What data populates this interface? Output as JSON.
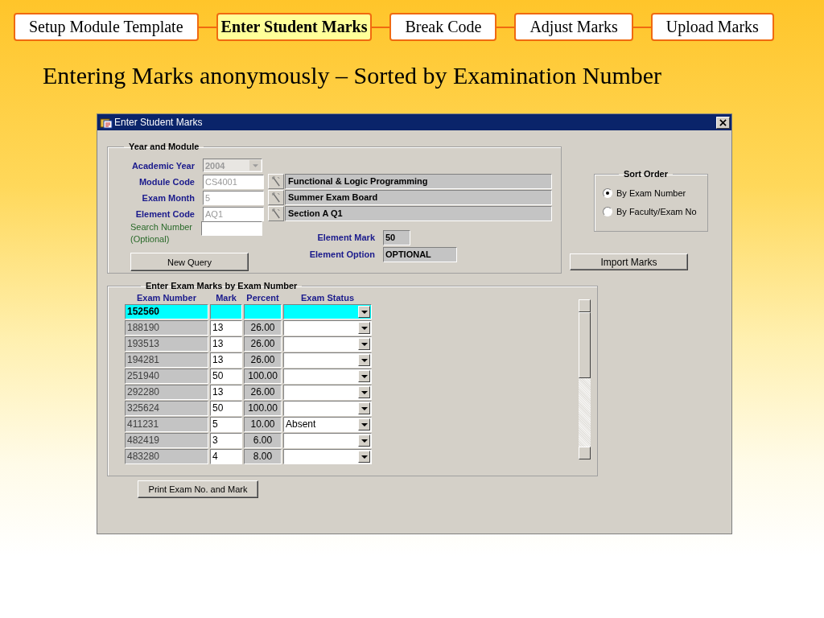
{
  "nav": [
    {
      "label": "Setup Module Template",
      "selected": false
    },
    {
      "label": "Enter Student Marks",
      "selected": true
    },
    {
      "label": "Break Code",
      "selected": false
    },
    {
      "label": "Adjust Marks",
      "selected": false
    },
    {
      "label": "Upload Marks",
      "selected": false
    }
  ],
  "heading": "Entering Marks anonymously – Sorted by Examination Number",
  "window": {
    "title": "Enter Student Marks",
    "module_group": {
      "legend": "Year and Module",
      "fields": [
        {
          "kind": "dropdown",
          "label": "Academic Year",
          "value": "2004"
        },
        {
          "kind": "lookup",
          "label": "Module Code",
          "value": "CS4001",
          "description": "Functional & Logic Programming"
        },
        {
          "kind": "lookup",
          "label": "Exam Month",
          "value": "5",
          "description": "Summer Exam Board"
        },
        {
          "kind": "lookup",
          "label": "Element Code",
          "value": "AQ1",
          "description": "Section A Q1"
        }
      ],
      "search": {
        "label": "Search Number",
        "hint": "(Optional)"
      },
      "new_query_button": "New Query",
      "element_mark": {
        "label": "Element Mark",
        "value": "50"
      },
      "element_option": {
        "label": "Element Option",
        "value": "OPTIONAL"
      }
    },
    "sort_order": {
      "legend": "Sort Order",
      "options": [
        {
          "label": "By Exam Number",
          "selected": true
        },
        {
          "label": "By Faculty/Exam No",
          "selected": false
        }
      ]
    },
    "import_button": "Import Marks",
    "marks_group": {
      "legend": "Enter Exam Marks by Exam Number",
      "columns": [
        "Exam Number",
        "Mark",
        "Percent",
        "Exam Status"
      ],
      "rows": [
        {
          "exam_number": "152560",
          "selected": true
        },
        {
          "exam_number": "188190",
          "mark": "13",
          "percent": "26.00",
          "selected": false
        },
        {
          "exam_number": "193513",
          "mark": "13",
          "percent": "26.00",
          "selected": false
        },
        {
          "exam_number": "194281",
          "mark": "13",
          "percent": "26.00",
          "selected": false
        },
        {
          "exam_number": "251940",
          "mark": "50",
          "percent": "100.00",
          "selected": false
        },
        {
          "exam_number": "292280",
          "mark": "13",
          "percent": "26.00",
          "selected": false
        },
        {
          "exam_number": "325624",
          "mark": "50",
          "percent": "100.00",
          "selected": false
        },
        {
          "exam_number": "411231",
          "mark": "5",
          "percent": "10.00",
          "status": "Absent",
          "selected": false
        },
        {
          "exam_number": "482419",
          "mark": "3",
          "percent": "6.00",
          "selected": false
        },
        {
          "exam_number": "483280",
          "mark": "4",
          "percent": "8.00",
          "selected": false
        }
      ]
    },
    "print_button": "Print Exam No. and Mark"
  }
}
